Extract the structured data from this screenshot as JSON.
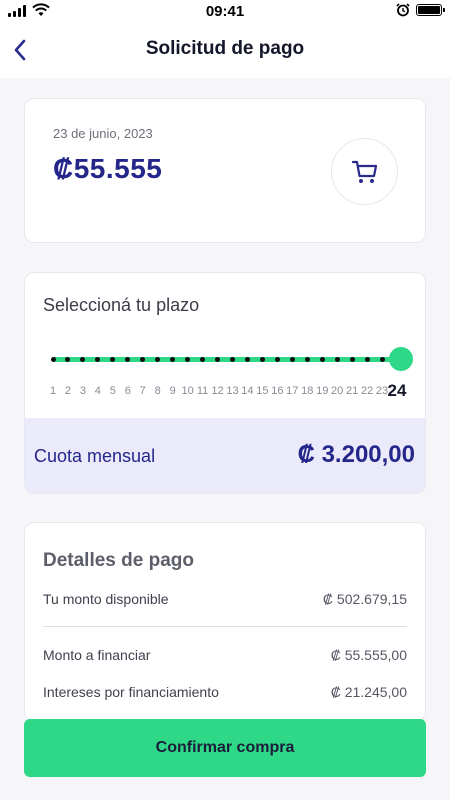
{
  "status_bar": {
    "time": "09:41"
  },
  "nav": {
    "title": "Solicitud de pago",
    "back_icon": "chevron-left-icon"
  },
  "summary": {
    "date": "23 de junio, 2023",
    "amount": "₡55.555",
    "icon": "shopping-cart-icon"
  },
  "plazo": {
    "title": "Seleccioná tu plazo",
    "ticks": [
      "1",
      "2",
      "3",
      "4",
      "5",
      "6",
      "7",
      "8",
      "9",
      "10",
      "11",
      "12",
      "13",
      "14",
      "15",
      "16",
      "17",
      "18",
      "19",
      "20",
      "21",
      "22",
      "23",
      "24"
    ],
    "selected": 24,
    "min": 1,
    "max": 24
  },
  "cuota": {
    "label": "Cuota mensual",
    "value": "₡ 3.200,00"
  },
  "details": {
    "title": "Detalles de pago",
    "rows": [
      {
        "label": "Tu monto disponible",
        "value": "₡ 502.679,15"
      },
      {
        "label": "Monto a financiar",
        "value": "₡ 55.555,00"
      },
      {
        "label": "Intereses por financiamiento",
        "value": "₡ 21.245,00"
      }
    ]
  },
  "actions": {
    "confirm_label": "Confirmar compra"
  },
  "colors": {
    "accent_green": "#2fd887",
    "brand_navy": "#24268a",
    "cuota_band": "#ebeafa"
  }
}
